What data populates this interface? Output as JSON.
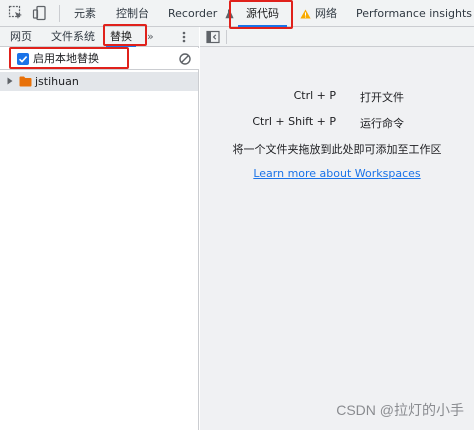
{
  "toolbar": {
    "tabs": [
      {
        "label": "元素"
      },
      {
        "label": "控制台"
      },
      {
        "label": "Recorder"
      },
      {
        "label": "源代码"
      },
      {
        "label": "网络"
      },
      {
        "label": "Performance insights"
      }
    ]
  },
  "navigator": {
    "tabs": [
      {
        "label": "网页"
      },
      {
        "label": "文件系统"
      },
      {
        "label": "替换"
      }
    ],
    "more": "»",
    "enable_overrides_label": "启用本地替换",
    "tree": [
      {
        "label": "jstihuan"
      }
    ]
  },
  "editor": {
    "shortcuts": [
      {
        "keys": "Ctrl + P",
        "action": "打开文件"
      },
      {
        "keys": "Ctrl + Shift + P",
        "action": "运行命令"
      }
    ],
    "drop_hint": "将一个文件夹拖放到此处即可添加至工作区",
    "learn_more": "Learn more about Workspaces"
  },
  "watermark": "CSDN @拉灯的小手",
  "colors": {
    "accent": "#1a73e8",
    "highlight_box": "#e0211b",
    "folder": "#e8710a",
    "warning": "#f9ab00"
  }
}
